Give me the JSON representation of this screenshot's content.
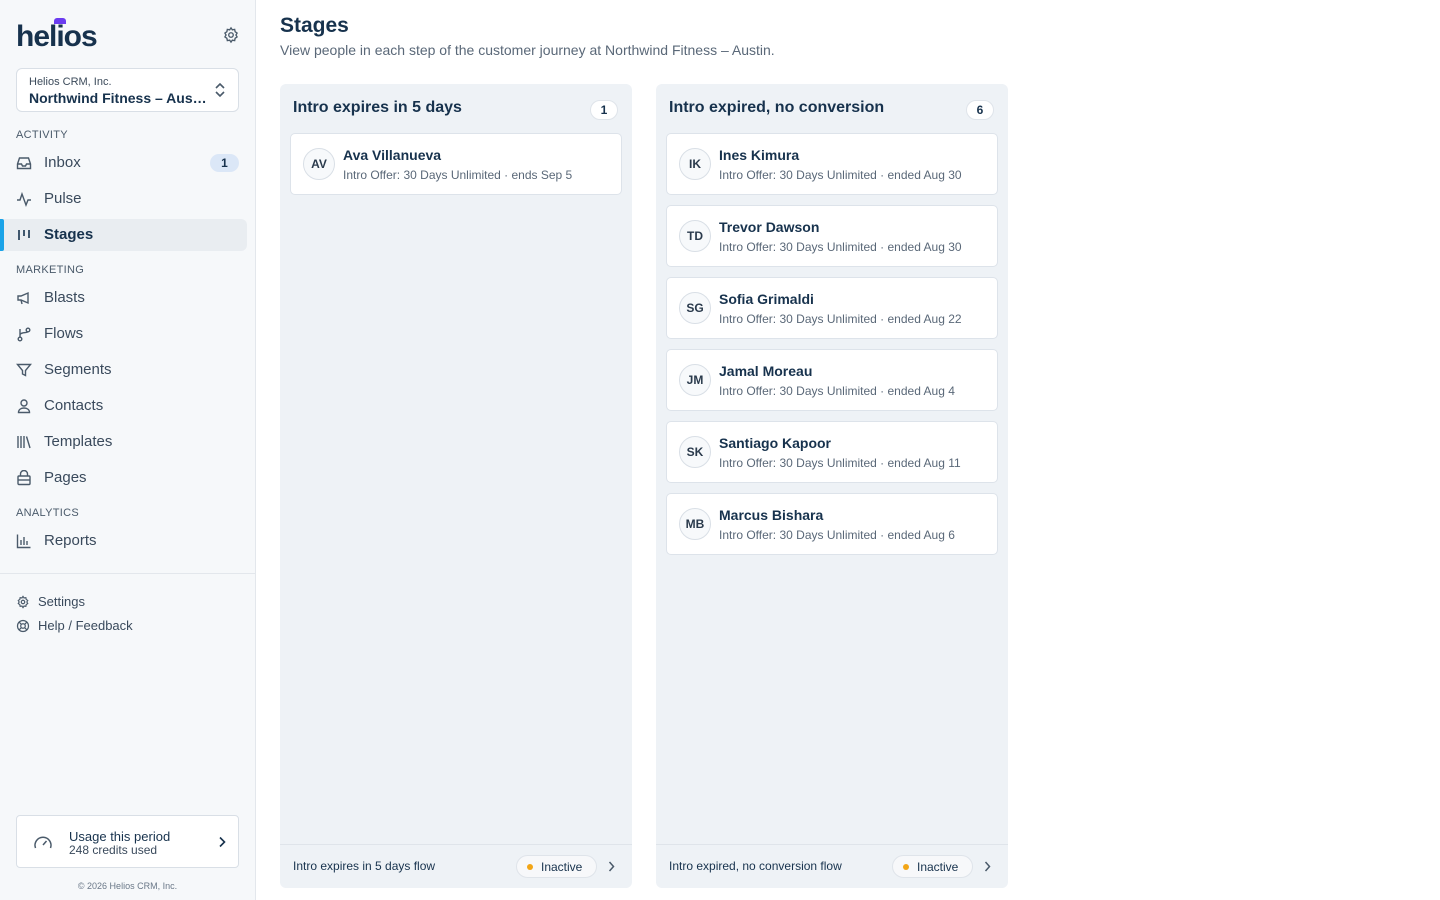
{
  "brand": {
    "name": "helios",
    "accent": "#6b3cf0"
  },
  "workspace": {
    "org": "Helios CRM, Inc.",
    "name": "Northwind Fitness – Austin"
  },
  "sidebar": {
    "sections": [
      {
        "label": "ACTIVITY"
      },
      {
        "label": "MARKETING"
      },
      {
        "label": "ANALYTICS"
      }
    ],
    "items": [
      {
        "label": "Inbox",
        "icon": "inbox-icon",
        "badge": "1"
      },
      {
        "label": "Pulse",
        "icon": "pulse-icon"
      },
      {
        "label": "Stages",
        "icon": "stages-icon",
        "active": true
      },
      {
        "label": "Blasts",
        "icon": "megaphone-icon"
      },
      {
        "label": "Flows",
        "icon": "flow-icon"
      },
      {
        "label": "Segments",
        "icon": "filter-icon"
      },
      {
        "label": "Contacts",
        "icon": "person-icon"
      },
      {
        "label": "Templates",
        "icon": "library-icon"
      },
      {
        "label": "Pages",
        "icon": "page-icon"
      },
      {
        "label": "Reports",
        "icon": "bar-chart-icon"
      }
    ],
    "footer_links": [
      {
        "label": "Settings",
        "icon": "gear-icon"
      },
      {
        "label": "Help / Feedback",
        "icon": "help-icon"
      }
    ],
    "usage": {
      "title": "Usage this period",
      "subtitle": "248 credits used"
    },
    "copyright": "© 2026 Helios CRM, Inc."
  },
  "page": {
    "title": "Stages",
    "subtitle": "View people in each step of the customer journey at Northwind Fitness – Austin."
  },
  "columns": [
    {
      "title": "Intro expires in 5 days",
      "count": "1",
      "cards": [
        {
          "initials": "AV",
          "name": "Ava Villanueva",
          "detail": "Intro Offer: 30 Days Unlimited · ends Sep 5"
        }
      ],
      "flow_label": "Intro expires in 5 days flow",
      "status": "Inactive"
    },
    {
      "title": "Intro expired, no conversion",
      "count": "6",
      "cards": [
        {
          "initials": "IK",
          "name": "Ines Kimura",
          "detail": "Intro Offer: 30 Days Unlimited · ended Aug 30"
        },
        {
          "initials": "TD",
          "name": "Trevor Dawson",
          "detail": "Intro Offer: 30 Days Unlimited · ended Aug 30"
        },
        {
          "initials": "SG",
          "name": "Sofia Grimaldi",
          "detail": "Intro Offer: 30 Days Unlimited · ended Aug 22"
        },
        {
          "initials": "JM",
          "name": "Jamal Moreau",
          "detail": "Intro Offer: 30 Days Unlimited · ended Aug 4"
        },
        {
          "initials": "SK",
          "name": "Santiago Kapoor",
          "detail": "Intro Offer: 30 Days Unlimited · ended Aug 11"
        },
        {
          "initials": "MB",
          "name": "Marcus Bishara",
          "detail": "Intro Offer: 30 Days Unlimited · ended Aug 6"
        }
      ],
      "flow_label": "Intro expired, no conversion flow",
      "status": "Inactive"
    }
  ]
}
